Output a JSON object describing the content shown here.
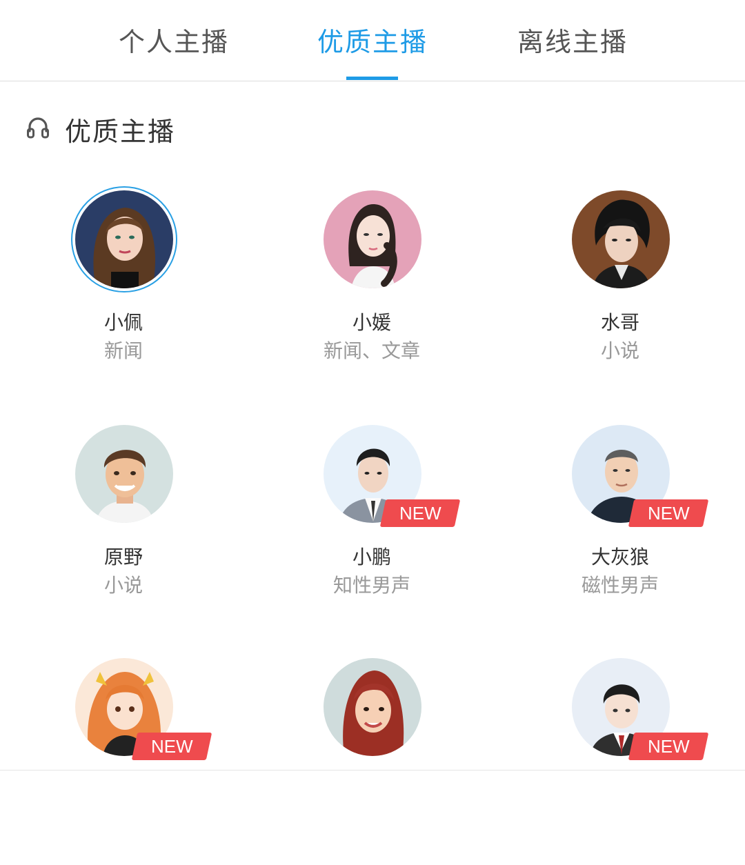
{
  "tabs": [
    {
      "label": "个人主播",
      "active": false
    },
    {
      "label": "优质主播",
      "active": true
    },
    {
      "label": "离线主播",
      "active": false
    }
  ],
  "section": {
    "title": "优质主播",
    "icon": "headphones-icon"
  },
  "anchors": [
    {
      "name": "小佩",
      "tag": "新闻",
      "new": false,
      "selected": true
    },
    {
      "name": "小媛",
      "tag": "新闻、文章",
      "new": false
    },
    {
      "name": "水哥",
      "tag": "小说",
      "new": false
    },
    {
      "name": "原野",
      "tag": "小说",
      "new": false
    },
    {
      "name": "小鹏",
      "tag": "知性男声",
      "new": true
    },
    {
      "name": "大灰狼",
      "tag": "磁性男声",
      "new": true
    },
    {
      "name": "",
      "tag": "",
      "new": true
    },
    {
      "name": "",
      "tag": "",
      "new": false
    },
    {
      "name": "",
      "tag": "",
      "new": true
    }
  ],
  "badge_label": "NEW",
  "colors": {
    "accent": "#1e9be6",
    "badge": "#ef4b4e"
  }
}
